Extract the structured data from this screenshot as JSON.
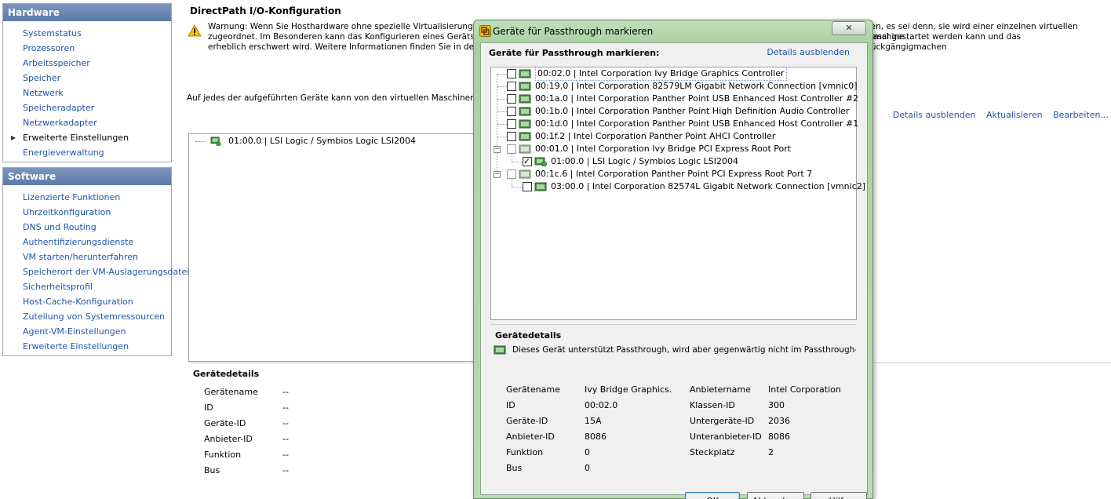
{
  "sidebar": {
    "hardware": {
      "title": "Hardware",
      "items": [
        {
          "label": "Systemstatus"
        },
        {
          "label": "Prozessoren"
        },
        {
          "label": "Arbeitsspeicher"
        },
        {
          "label": "Speicher"
        },
        {
          "label": "Netzwerk"
        },
        {
          "label": "Speicheradapter"
        },
        {
          "label": "Netzwerkadapter"
        },
        {
          "label": "Erweiterte Einstellungen"
        },
        {
          "label": "Energieverwaltung"
        }
      ]
    },
    "software": {
      "title": "Software",
      "items": [
        {
          "label": "Lizenzierte Funktionen"
        },
        {
          "label": "Uhrzeitkonfiguration"
        },
        {
          "label": "DNS und Routing"
        },
        {
          "label": "Authentifizierungsdienste"
        },
        {
          "label": "VM starten/herunterfahren"
        },
        {
          "label": "Speicherort der VM-Auslagerungsdatei"
        },
        {
          "label": "Sicherheitsprofil"
        },
        {
          "label": "Host-Cache-Konfiguration"
        },
        {
          "label": "Zuteilung von Systemressourcen"
        },
        {
          "label": "Agent-VM-Einstellungen"
        },
        {
          "label": "Erweiterte Einstellungen"
        }
      ]
    }
  },
  "main": {
    "title": "DirectPath I/O-Konfiguration",
    "warning_line1_a": "Warnung: Wenn Sie Hosthardware ohne spezielle Virtualisierungsfunkt",
    "warning_line1_b": "den, es sei denn, sie wird einer einzelnen virtuellen Maschine",
    "warning_line2_a": "zugeordnet. Im Besonderen kann das Konfigurieren eines Geräts, das",
    "warning_line2_b": "ormal gestartet werden kann und das Rückgängigmachen",
    "warning_line3_a": "erheblich erschwert wird. Weitere Informationen finden Sie in der Onli",
    "available_text": "Auf jedes der aufgeführten Geräte kann von den virtuellen Maschinen auf di",
    "links": {
      "hide_details": "Details ausblenden",
      "refresh": "Aktualisieren",
      "edit": "Bearbeiten..."
    },
    "device": "01:00.0 | LSI Logic / Symbios Logic LSI2004",
    "details_title": "Gerätedetails",
    "details": [
      {
        "label": "Gerätename",
        "value": "--"
      },
      {
        "label": "ID",
        "value": "--"
      },
      {
        "label": "Geräte-ID",
        "value": "--"
      },
      {
        "label": "Anbieter-ID",
        "value": "--"
      },
      {
        "label": "Funktion",
        "value": "--"
      },
      {
        "label": "Bus",
        "value": "--"
      }
    ]
  },
  "dialog": {
    "title": "Geräte für Passthrough markieren",
    "heading": "Geräte für Passthrough markieren:",
    "hide_details": "Details ausblenden",
    "close_symbol": "✕",
    "devices": [
      {
        "label": "00:02.0 | Intel Corporation Ivy Bridge Graphics Controller",
        "checked": false
      },
      {
        "label": "00:19.0 | Intel Corporation 82579LM Gigabit Network Connection [vmnic0]",
        "checked": false
      },
      {
        "label": "00:1a.0 | Intel Corporation Panther Point USB Enhanced Host Controller #2",
        "checked": false
      },
      {
        "label": "00:1b.0 | Intel Corporation Panther Point High Definition Audio Controller",
        "checked": false
      },
      {
        "label": "00:1d.0 | Intel Corporation Panther Point USB Enhanced Host Controller #1",
        "checked": false
      },
      {
        "label": "00:1f.2 | Intel Corporation Panther Point AHCI Controller",
        "checked": false
      },
      {
        "label": "00:01.0 | Intel Corporation Ivy Bridge PCI Express Root Port",
        "checked": false
      },
      {
        "label": "01:00.0 | LSI Logic / Symbios Logic LSI2004",
        "checked": true
      },
      {
        "label": "00:1c.6 | Intel Corporation Panther Point PCI Express Root Port 7",
        "checked": false
      },
      {
        "label": "03:00.0 | Intel Corporation 82574L Gigabit Network Connection [vmnic2]",
        "checked": false
      }
    ],
    "details_title": "Gerätedetails",
    "details_note": "Dieses Gerät unterstützt Passthrough, wird aber gegenwärtig nicht im Passthrough-Modus a",
    "details": [
      {
        "l1": "Gerätename",
        "v1": "Ivy Bridge Graphics.",
        "l2": "Anbietername",
        "v2": "Intel Corporation"
      },
      {
        "l1": "ID",
        "v1": "00:02.0",
        "l2": "Klassen-ID",
        "v2": "300"
      },
      {
        "l1": "Geräte-ID",
        "v1": "15A",
        "l2": "Untergeräte-ID",
        "v2": "2036"
      },
      {
        "l1": "Anbieter-ID",
        "v1": "8086",
        "l2": "Unteranbieter-ID",
        "v2": "8086"
      },
      {
        "l1": "Funktion",
        "v1": "0",
        "l2": "Steckplatz",
        "v2": "2"
      },
      {
        "l1": "Bus",
        "v1": "0",
        "l2": "",
        "v2": ""
      }
    ],
    "buttons": {
      "ok": "OK",
      "cancel": "Abbrechen",
      "help": "Hilfe"
    }
  },
  "colors": {
    "link": "#1f55a8",
    "panel_header": "#6a87b3",
    "dialog_frame": "#b2d8ab"
  }
}
